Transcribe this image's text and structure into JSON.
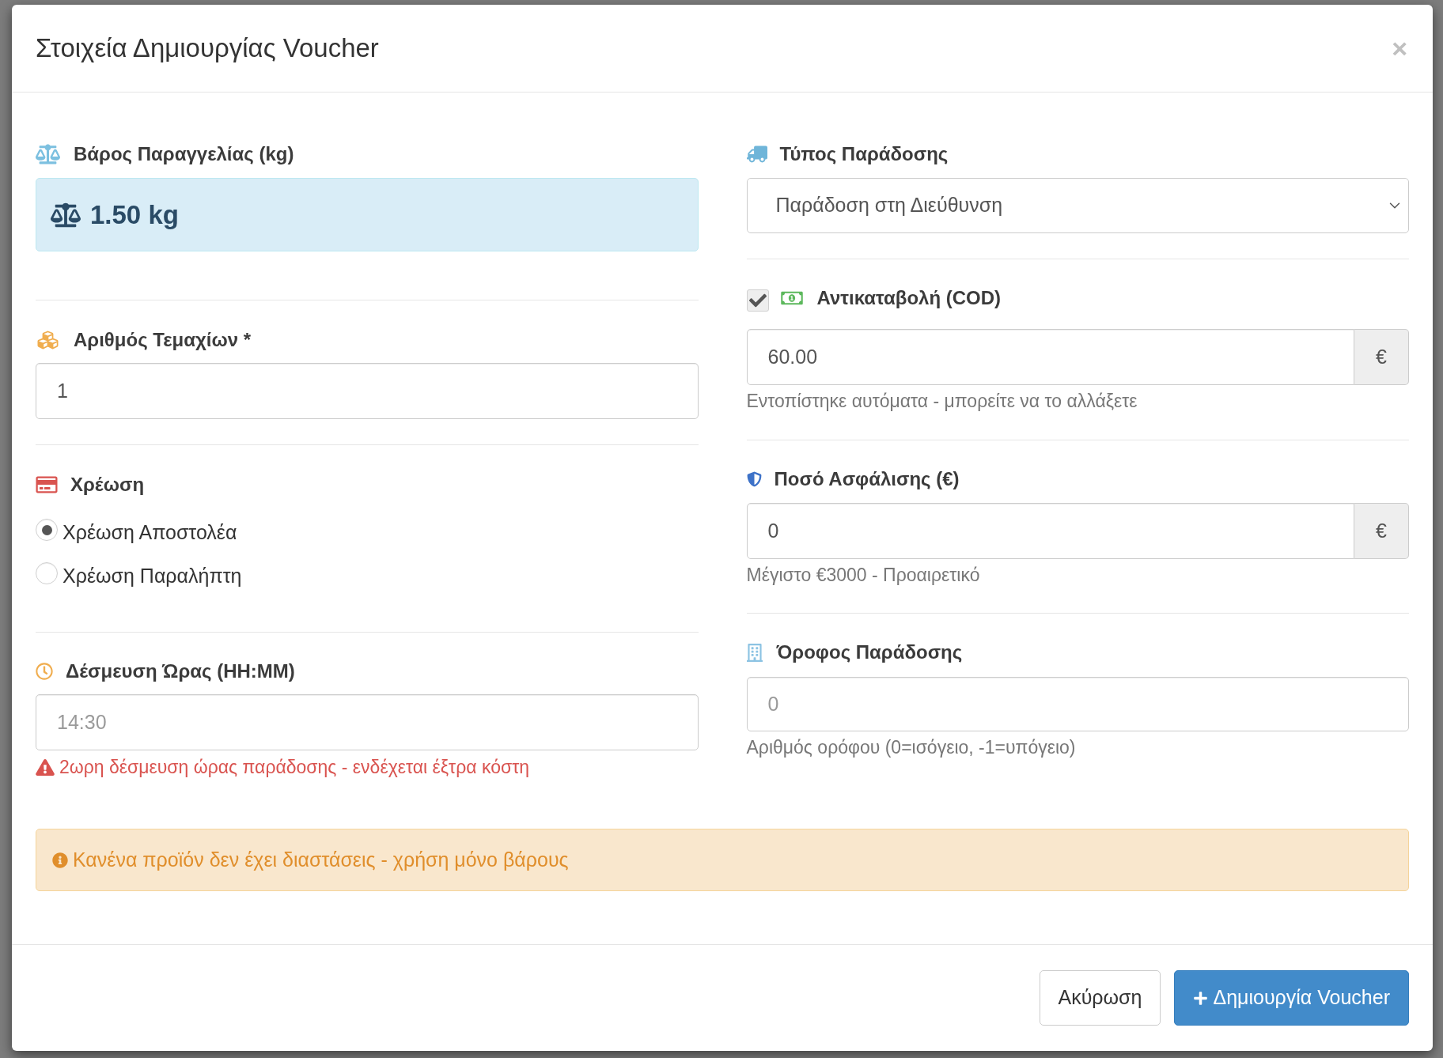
{
  "modal": {
    "title": "Στοιχεία Δημιουργίας Voucher",
    "close": "×"
  },
  "weight": {
    "label": "Βάρος Παραγγελίας (kg)",
    "value": "1.50 kg"
  },
  "pieces": {
    "label": "Αριθμός Τεμαχίων *",
    "value": "1"
  },
  "charge": {
    "label": "Χρέωση",
    "options": [
      {
        "label": "Χρέωση Αποστολέα",
        "selected": true
      },
      {
        "label": "Χρέωση Παραλήπτη",
        "selected": false
      }
    ]
  },
  "time_slot": {
    "label": "Δέσμευση Ώρας (HH:MM)",
    "placeholder": "14:30",
    "warning": "2ωρη δέσμευση ώρας παράδοσης - ενδέχεται έξτρα κόστη"
  },
  "delivery_type": {
    "label": "Τύπος Παράδοσης",
    "value": "Παράδοση στη Διεύθυνση"
  },
  "cod": {
    "label": "Αντικαταβολή (COD)",
    "checked": true,
    "value": "60.00",
    "addon": "€",
    "help": "Εντοπίστηκε αυτόματα - μπορείτε να το αλλάξετε"
  },
  "insurance": {
    "label": "Ποσό Ασφάλισης (€)",
    "value": "0",
    "addon": "€",
    "help": "Μέγιστο €3000 - Προαιρετικό"
  },
  "floor": {
    "label": "Όροφος Παράδοσης",
    "placeholder": "0",
    "help": "Αριθμός ορόφου (0=ισόγειο, -1=υπόγειο)"
  },
  "alert": {
    "text": "Κανένα προϊόν δεν έχει διαστάσεις - χρήση μόνο βάρους"
  },
  "buttons": [
    {
      "label": "Ακύρωση",
      "kind": "default"
    },
    {
      "label": "Δημιουργία Voucher",
      "kind": "primary"
    }
  ]
}
